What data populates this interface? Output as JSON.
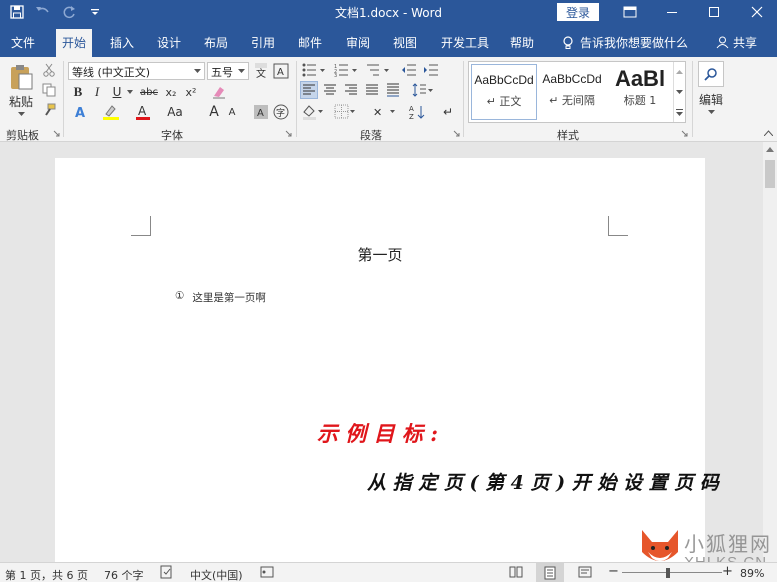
{
  "window": {
    "title": "文档1.docx  -  Word",
    "login_label": "登录"
  },
  "tabs": [
    {
      "label": "文件"
    },
    {
      "label": "开始"
    },
    {
      "label": "插入"
    },
    {
      "label": "设计"
    },
    {
      "label": "布局"
    },
    {
      "label": "引用"
    },
    {
      "label": "邮件"
    },
    {
      "label": "审阅"
    },
    {
      "label": "视图"
    },
    {
      "label": "开发工具"
    },
    {
      "label": "帮助"
    }
  ],
  "tellme": {
    "label": "告诉我你想要做什么"
  },
  "share": {
    "label": "共享"
  },
  "ribbon": {
    "clipboard": {
      "paste_label": "粘贴",
      "group_label": "剪贴板"
    },
    "font": {
      "font_name": "等线 (中文正文)",
      "font_size": "五号",
      "group_label": "字体",
      "grow_label": "A",
      "shrink_label": "A",
      "case_label": "Aa"
    },
    "paragraph": {
      "group_label": "段落"
    },
    "styles": {
      "group_label": "样式",
      "items": [
        {
          "sample": "AaBbCcDd",
          "name": "正文"
        },
        {
          "sample": "AaBbCcDd",
          "name": "无间隔"
        },
        {
          "sample": "AaBl",
          "name": "标题 1"
        }
      ]
    },
    "editing": {
      "label": "编辑"
    }
  },
  "document": {
    "heading": "第一页",
    "list_item_marker": "①",
    "list_item_text": "这里是第一页啊",
    "annotation_title": "示 例 目 标 :",
    "annotation_text": "从 指 定 页 ( 第 4 页 ) 开 始 设 置 页 码"
  },
  "statusbar": {
    "page_info": "第 1 页，共 6 页",
    "word_count": "76 个字",
    "language": "中文(中国)",
    "zoom": "89%"
  },
  "watermark": {
    "title": "小狐狸网",
    "subtitle": "XHLKS.CN"
  },
  "colors": {
    "brand": "#2b579a",
    "annotation_red": "#e0161b"
  }
}
